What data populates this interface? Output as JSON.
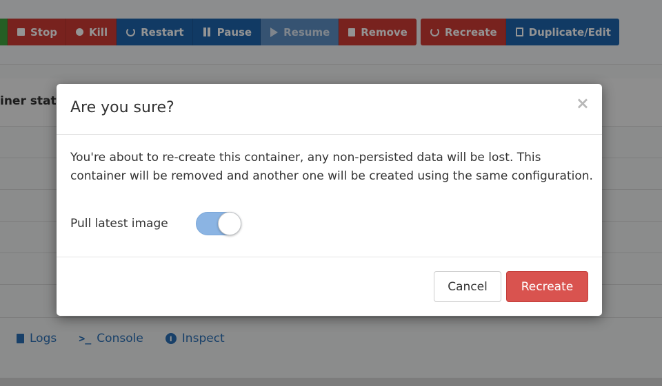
{
  "toolbar": {
    "group1": [
      {
        "label": "",
        "color": "green"
      },
      {
        "label": "Stop",
        "icon": "stop-square-icon",
        "color": "red"
      },
      {
        "label": "Kill",
        "icon": "bomb-icon",
        "color": "red"
      },
      {
        "label": "Restart",
        "icon": "refresh-icon",
        "color": "blue"
      },
      {
        "label": "Pause",
        "icon": "pause-icon",
        "color": "blue"
      },
      {
        "label": "Resume",
        "icon": "play-icon",
        "color": "blue-disabled"
      },
      {
        "label": "Remove",
        "icon": "trash-icon",
        "color": "red"
      }
    ],
    "group2": [
      {
        "label": "Recreate",
        "icon": "refresh-icon",
        "color": "red"
      },
      {
        "label": "Duplicate/Edit",
        "icon": "copy-icon",
        "color": "blue"
      }
    ]
  },
  "background": {
    "section_header": "iner stat",
    "links": [
      {
        "label": "Logs",
        "icon": "file-icon"
      },
      {
        "label": "Console",
        "icon": "terminal-icon",
        "glyph": ">_"
      },
      {
        "label": "Inspect",
        "icon": "info-icon",
        "glyph": "i"
      }
    ]
  },
  "modal": {
    "title": "Are you sure?",
    "close_glyph": "×",
    "message": "You're about to re-create this container, any non-persisted data will be lost. This container will be removed and another one will be created using the same configuration.",
    "toggle_label": "Pull latest image",
    "toggle_on": true,
    "cancel_label": "Cancel",
    "confirm_label": "Recreate"
  },
  "colors": {
    "danger": "#d9534f",
    "primary": "#1e65ad",
    "toggle_on": "#8bb4e3"
  }
}
